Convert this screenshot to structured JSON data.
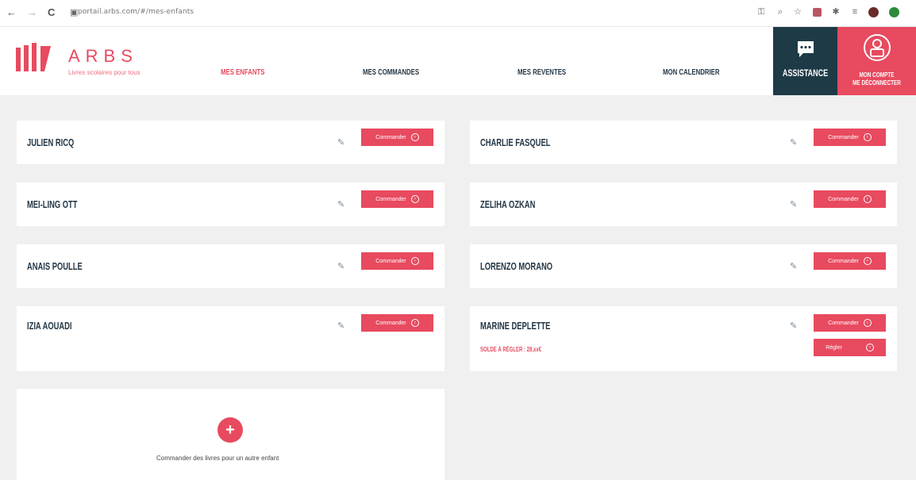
{
  "browser": {
    "url": "portail.arbs.com/#/mes-enfants",
    "back": "←",
    "forward": "→",
    "reload": "C"
  },
  "brand": {
    "name": "ARBS",
    "tagline": "Livres scolaires pour tous",
    "accent": "#e84a5f",
    "dark": "#1e3a47"
  },
  "nav": {
    "items": [
      {
        "label": "MES ENFANTS",
        "active": true
      },
      {
        "label": "MES COMMANDES",
        "active": false
      },
      {
        "label": "MES REVENTES",
        "active": false
      },
      {
        "label": "MON CALENDRIER",
        "active": false
      }
    ]
  },
  "assistance": {
    "label": "ASSISTANCE",
    "icon": "chat-bubble-icon"
  },
  "account": {
    "label_line1": "MON COMPTE",
    "label_line2": "ME DÉCONNECTER",
    "icon": "user-icon"
  },
  "children": [
    {
      "name": "JULIEN RICQ",
      "order_label": "Commander"
    },
    {
      "name": "CHARLIE FASQUEL",
      "order_label": "Commander"
    },
    {
      "name": "MEI-LING OTT",
      "order_label": "Commander"
    },
    {
      "name": "ZELIHA OZKAN",
      "order_label": "Commander"
    },
    {
      "name": "ANAIS POULLE",
      "order_label": "Commander"
    },
    {
      "name": "LORENZO MORANO",
      "order_label": "Commander"
    },
    {
      "name": "IZIA AOUADI",
      "order_label": "Commander"
    },
    {
      "name": "MARINE DEPLETTE",
      "order_label": "Commander",
      "pay_label": "Régler",
      "balance": "SOLDE À RÉGLER : 28,xx€"
    }
  ],
  "add_child": {
    "symbol": "+",
    "label": "Commander des livres pour un autre enfant"
  }
}
